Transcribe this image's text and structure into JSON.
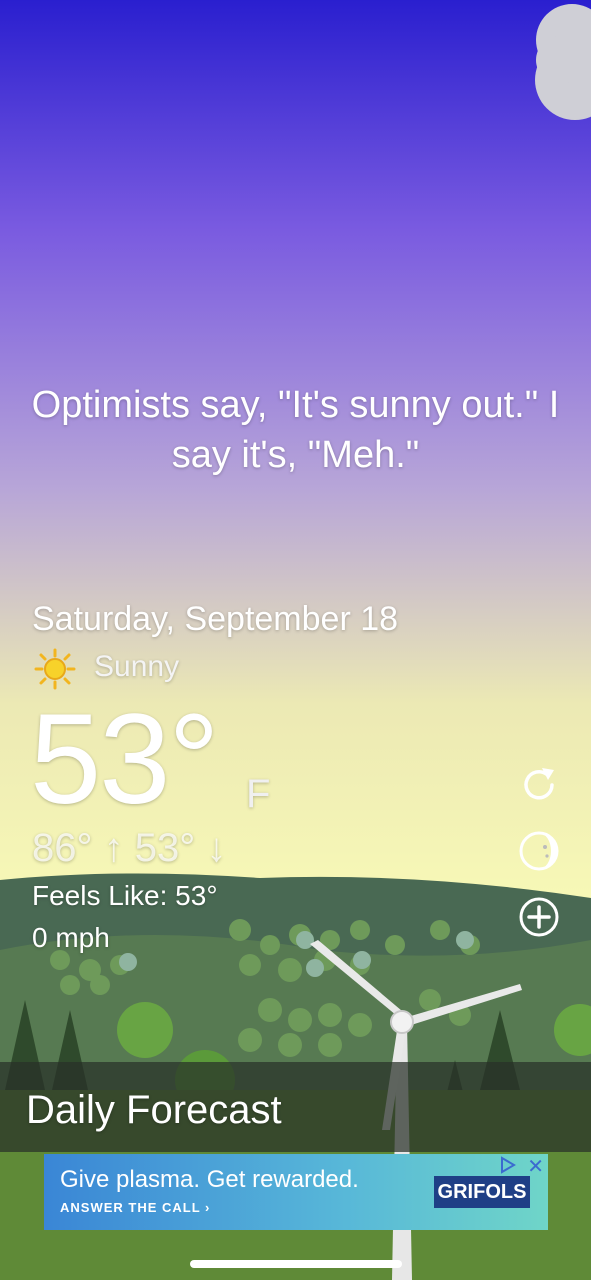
{
  "weather": {
    "quote": "Optimists say, \"It's sunny out.\" I say it's, \"Meh.\"",
    "date": "Saturday, September 18",
    "condition": "Sunny",
    "temperature": "53°",
    "unit": "F",
    "high_low": "86° ↑  53° ↓",
    "feels_like": "Feels Like: 53°",
    "wind": "0 mph"
  },
  "actions": {
    "refresh_icon": "refresh-icon",
    "moon_icon": "moon-phase-icon",
    "add_icon": "add-location-icon"
  },
  "forecast": {
    "title": "Daily Forecast"
  },
  "ad": {
    "headline": "Give plasma. Get rewarded.",
    "cta": "ANSWER THE CALL ›",
    "brand": "GRIFOLS",
    "close_label": "✕"
  },
  "colors": {
    "sky_top": "#2a1fcf",
    "sky_mid": "#9a86e0",
    "sky_horizon": "#f7f8b6",
    "hills": "#4f6c56",
    "ground": "#5f8a37"
  }
}
